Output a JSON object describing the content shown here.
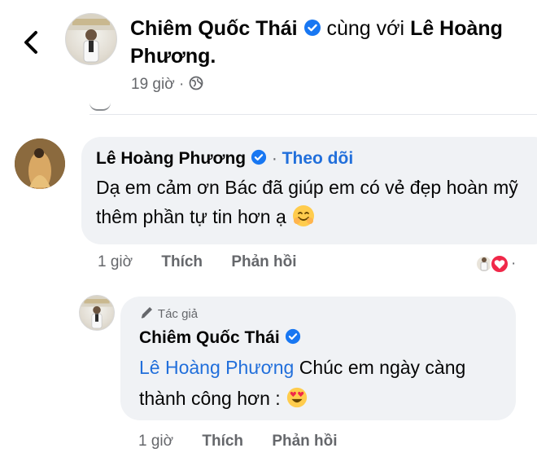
{
  "header": {
    "author_name": "Chiêm Quốc Thái",
    "with_text": "cùng với",
    "tagged_name": "Lê Hoàng Phương.",
    "time": "19 giờ",
    "separator": "·"
  },
  "comment": {
    "author_name": "Lê Hoàng Phương",
    "separator": "·",
    "follow_label": "Theo dõi",
    "text": "Dạ em cảm ơn Bác đã giúp em có vẻ đẹp hoàn mỹ thêm phần tự tin hơn ạ",
    "time": "1 giờ",
    "like_label": "Thích",
    "reply_label": "Phản hồi",
    "reaction_more": "·"
  },
  "reply": {
    "author_badge": "Tác giả",
    "author_name": "Chiêm Quốc Thái",
    "mention": "Lê Hoàng Phương",
    "text": "Chúc em ngày càng thành công hơn :",
    "time": "1 giờ",
    "like_label": "Thích",
    "reply_label": "Phản hồi"
  },
  "colors": {
    "verified": "#1877f2",
    "link": "#216fdb",
    "meta": "#65676b",
    "bubble": "#f0f2f5",
    "love": "#f02849"
  },
  "icons": {
    "back": "chevron-left-icon",
    "verified": "verified-badge-icon",
    "globe": "globe-icon",
    "author": "pen-icon",
    "smile": "smiling-face-emoji",
    "heart_eyes": "heart-eyes-emoji",
    "love": "love-reaction-icon"
  }
}
